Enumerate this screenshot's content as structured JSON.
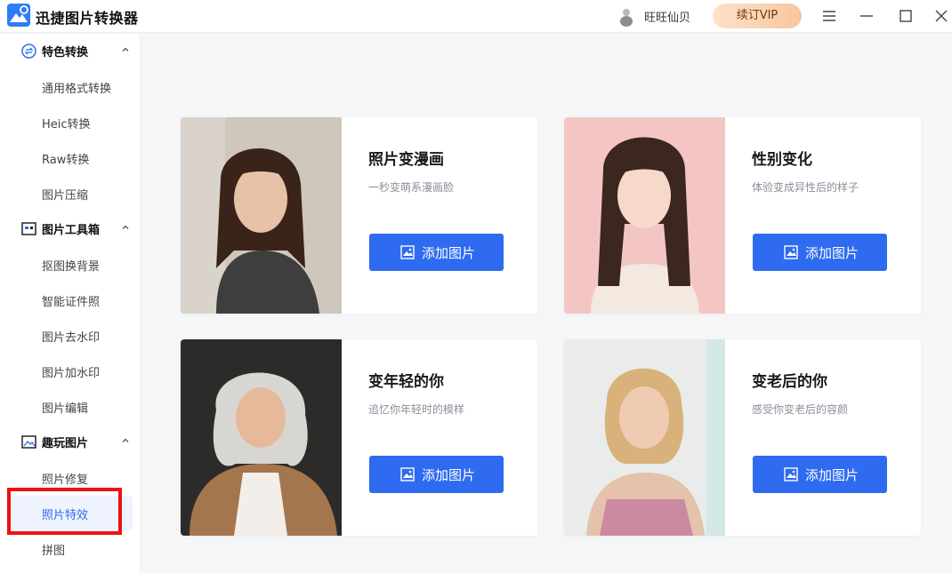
{
  "app": {
    "title": "迅捷图片转换器"
  },
  "header": {
    "username": "旺旺仙贝",
    "vip_label": "续订VIP"
  },
  "colors": {
    "accent": "#2e6bf0",
    "highlight": "#ee1111",
    "vip": "#f7c79f"
  },
  "sidebar": {
    "sections": [
      {
        "label": "特色转换",
        "icon": "convert-icon",
        "items": [
          "通用格式转换",
          "Heic转换",
          "Raw转换",
          "图片压缩"
        ]
      },
      {
        "label": "图片工具箱",
        "icon": "toolbox-icon",
        "items": [
          "抠图换背景",
          "智能证件照",
          "图片去水印",
          "图片加水印",
          "图片编辑"
        ]
      },
      {
        "label": "趣玩图片",
        "icon": "fun-image-icon",
        "items": [
          "照片修复",
          "照片特效",
          "拼图"
        ]
      }
    ],
    "active_item": "照片特效"
  },
  "cards": [
    {
      "title": "照片变漫画",
      "subtitle": "一秒变萌系漫画脸",
      "button": "添加图片"
    },
    {
      "title": "性别变化",
      "subtitle": "体验变成异性后的样子",
      "button": "添加图片"
    },
    {
      "title": "变年轻的你",
      "subtitle": "追忆你年轻时的模样",
      "button": "添加图片"
    },
    {
      "title": "变老后的你",
      "subtitle": "感受你变老后的容颜",
      "button": "添加图片"
    }
  ]
}
